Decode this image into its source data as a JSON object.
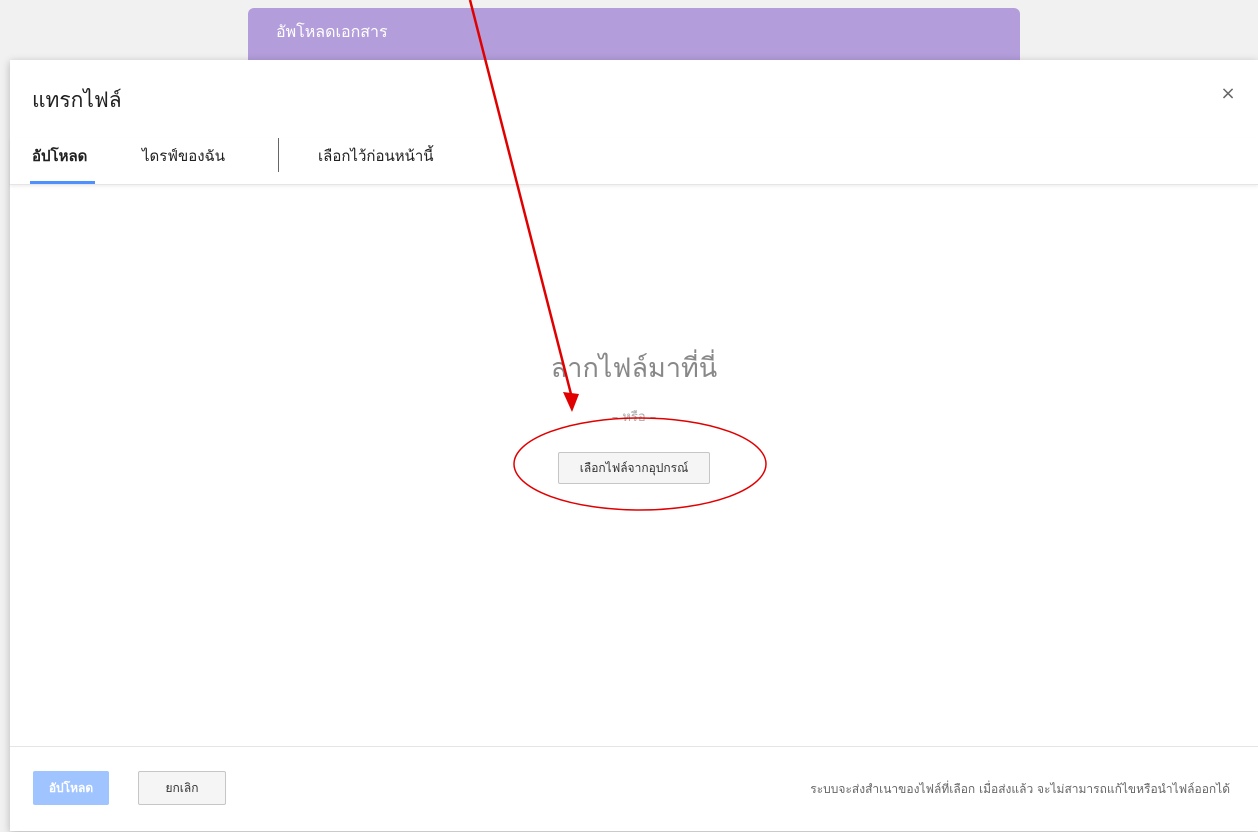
{
  "background": {
    "header_title": "อัพโหลดเอกสาร"
  },
  "dialog": {
    "title": "แทรกไฟล์",
    "close_symbol": "×",
    "tabs": [
      {
        "label": "อัปโหลด",
        "active": true
      },
      {
        "label": "ไดรฟ์ของฉัน",
        "active": false
      },
      {
        "label": "เลือกไว้ก่อนหน้านี้",
        "active": false
      }
    ],
    "drop_text": "ลากไฟล์มาที่นี่",
    "or_text": "– หรือ –",
    "select_button_label": "เลือกไฟล์จากอุปกรณ์",
    "footer": {
      "upload_label": "อัปโหลด",
      "cancel_label": "ยกเลิก",
      "note": "ระบบจะส่งสำเนาของไฟล์ที่เลือก เมื่อส่งแล้ว จะไม่สามารถแก้ไขหรือนำไฟล์ออกได้"
    }
  },
  "colors": {
    "header_purple": "#b39ddb",
    "tab_underline": "#4d90fe",
    "upload_disabled": "#a0c4ff",
    "annotation_red": "#e00000"
  }
}
